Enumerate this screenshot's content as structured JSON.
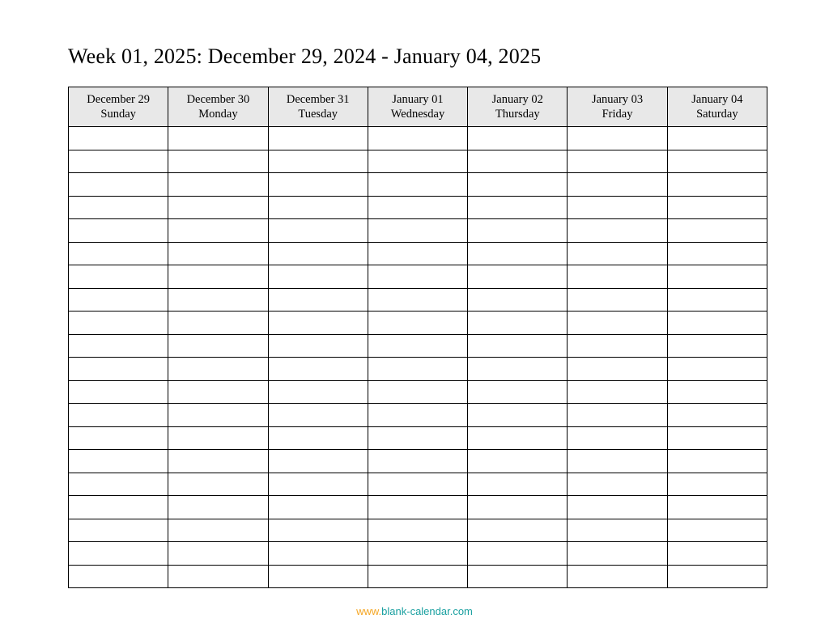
{
  "title": "Week 01, 2025: December 29, 2024 - January 04, 2025",
  "days": [
    {
      "date": "December 29",
      "weekday": "Sunday"
    },
    {
      "date": "December 30",
      "weekday": "Monday"
    },
    {
      "date": "December 31",
      "weekday": "Tuesday"
    },
    {
      "date": "January 01",
      "weekday": "Wednesday"
    },
    {
      "date": "January 02",
      "weekday": "Thursday"
    },
    {
      "date": "January 03",
      "weekday": "Friday"
    },
    {
      "date": "January 04",
      "weekday": "Saturday"
    }
  ],
  "body_row_count": 20,
  "footer": {
    "prefix": "www.",
    "domain": "blank-calendar.com"
  }
}
